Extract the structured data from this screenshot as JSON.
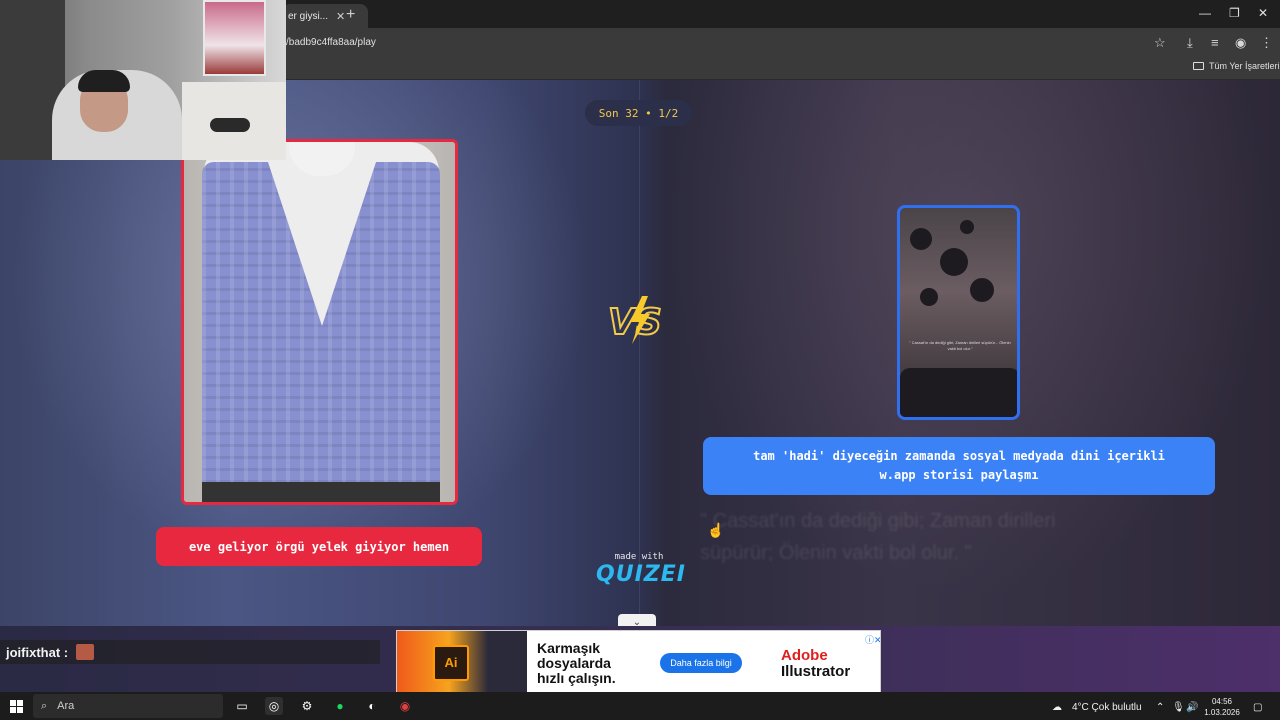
{
  "browser": {
    "tab_title": "er giysi...",
    "url": "/badb9c4ffa8aa/play",
    "bookmarks_all": "Tüm Yer İşaretleri"
  },
  "quiz": {
    "counter": "Son 32 • 1/2",
    "left_caption": "eve geliyor örgü yelek giyiyor hemen",
    "right_caption_line1": "tam 'hadi' diyeceğin zamanda sosyal medyada dini içerikli",
    "right_caption_line2": "w.app storisi paylaşmı",
    "vs": "VS",
    "story_quote": "\" Cassat'ın da dediği gibi; Zaman dirilleri süpürür... Ölenin vakti bol olur.\"",
    "blurred_quote": "\" Cassat'ın da dediği gibi; Zaman dirilleri süpürür; Ölenin vakti bol olur. \"",
    "made_with": "made with",
    "brand": "QUIZEI",
    "accent_red": "#e8283f",
    "accent_blue": "#3b82f6"
  },
  "chat": {
    "username": "joifixthat :"
  },
  "ad": {
    "headline_1": "Karmaşık",
    "headline_2": "dosyalarda",
    "headline_3": "hızlı çalışın.",
    "button": "Daha fazla bilgi",
    "brand_1": "Adobe",
    "brand_2": "Illustrator",
    "ai_label": "Ai"
  },
  "taskbar": {
    "search_placeholder": "Ara",
    "weather": "4°C  Çok bulutlu",
    "time": "04:56",
    "date": "1.03.2026"
  }
}
